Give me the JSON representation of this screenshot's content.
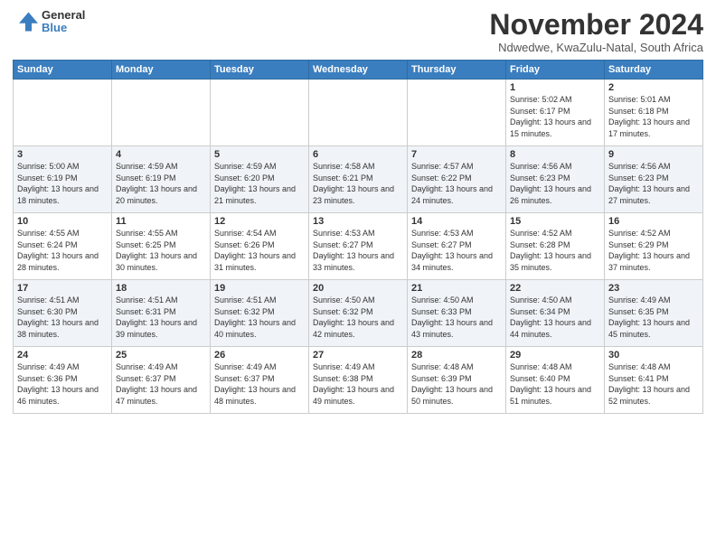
{
  "logo": {
    "general": "General",
    "blue": "Blue"
  },
  "title": "November 2024",
  "location": "Ndwedwe, KwaZulu-Natal, South Africa",
  "days_of_week": [
    "Sunday",
    "Monday",
    "Tuesday",
    "Wednesday",
    "Thursday",
    "Friday",
    "Saturday"
  ],
  "weeks": [
    [
      {
        "day": "",
        "info": ""
      },
      {
        "day": "",
        "info": ""
      },
      {
        "day": "",
        "info": ""
      },
      {
        "day": "",
        "info": ""
      },
      {
        "day": "",
        "info": ""
      },
      {
        "day": "1",
        "info": "Sunrise: 5:02 AM\nSunset: 6:17 PM\nDaylight: 13 hours\nand 15 minutes."
      },
      {
        "day": "2",
        "info": "Sunrise: 5:01 AM\nSunset: 6:18 PM\nDaylight: 13 hours\nand 17 minutes."
      }
    ],
    [
      {
        "day": "3",
        "info": "Sunrise: 5:00 AM\nSunset: 6:19 PM\nDaylight: 13 hours\nand 18 minutes."
      },
      {
        "day": "4",
        "info": "Sunrise: 4:59 AM\nSunset: 6:19 PM\nDaylight: 13 hours\nand 20 minutes."
      },
      {
        "day": "5",
        "info": "Sunrise: 4:59 AM\nSunset: 6:20 PM\nDaylight: 13 hours\nand 21 minutes."
      },
      {
        "day": "6",
        "info": "Sunrise: 4:58 AM\nSunset: 6:21 PM\nDaylight: 13 hours\nand 23 minutes."
      },
      {
        "day": "7",
        "info": "Sunrise: 4:57 AM\nSunset: 6:22 PM\nDaylight: 13 hours\nand 24 minutes."
      },
      {
        "day": "8",
        "info": "Sunrise: 4:56 AM\nSunset: 6:23 PM\nDaylight: 13 hours\nand 26 minutes."
      },
      {
        "day": "9",
        "info": "Sunrise: 4:56 AM\nSunset: 6:23 PM\nDaylight: 13 hours\nand 27 minutes."
      }
    ],
    [
      {
        "day": "10",
        "info": "Sunrise: 4:55 AM\nSunset: 6:24 PM\nDaylight: 13 hours\nand 28 minutes."
      },
      {
        "day": "11",
        "info": "Sunrise: 4:55 AM\nSunset: 6:25 PM\nDaylight: 13 hours\nand 30 minutes."
      },
      {
        "day": "12",
        "info": "Sunrise: 4:54 AM\nSunset: 6:26 PM\nDaylight: 13 hours\nand 31 minutes."
      },
      {
        "day": "13",
        "info": "Sunrise: 4:53 AM\nSunset: 6:27 PM\nDaylight: 13 hours\nand 33 minutes."
      },
      {
        "day": "14",
        "info": "Sunrise: 4:53 AM\nSunset: 6:27 PM\nDaylight: 13 hours\nand 34 minutes."
      },
      {
        "day": "15",
        "info": "Sunrise: 4:52 AM\nSunset: 6:28 PM\nDaylight: 13 hours\nand 35 minutes."
      },
      {
        "day": "16",
        "info": "Sunrise: 4:52 AM\nSunset: 6:29 PM\nDaylight: 13 hours\nand 37 minutes."
      }
    ],
    [
      {
        "day": "17",
        "info": "Sunrise: 4:51 AM\nSunset: 6:30 PM\nDaylight: 13 hours\nand 38 minutes."
      },
      {
        "day": "18",
        "info": "Sunrise: 4:51 AM\nSunset: 6:31 PM\nDaylight: 13 hours\nand 39 minutes."
      },
      {
        "day": "19",
        "info": "Sunrise: 4:51 AM\nSunset: 6:32 PM\nDaylight: 13 hours\nand 40 minutes."
      },
      {
        "day": "20",
        "info": "Sunrise: 4:50 AM\nSunset: 6:32 PM\nDaylight: 13 hours\nand 42 minutes."
      },
      {
        "day": "21",
        "info": "Sunrise: 4:50 AM\nSunset: 6:33 PM\nDaylight: 13 hours\nand 43 minutes."
      },
      {
        "day": "22",
        "info": "Sunrise: 4:50 AM\nSunset: 6:34 PM\nDaylight: 13 hours\nand 44 minutes."
      },
      {
        "day": "23",
        "info": "Sunrise: 4:49 AM\nSunset: 6:35 PM\nDaylight: 13 hours\nand 45 minutes."
      }
    ],
    [
      {
        "day": "24",
        "info": "Sunrise: 4:49 AM\nSunset: 6:36 PM\nDaylight: 13 hours\nand 46 minutes."
      },
      {
        "day": "25",
        "info": "Sunrise: 4:49 AM\nSunset: 6:37 PM\nDaylight: 13 hours\nand 47 minutes."
      },
      {
        "day": "26",
        "info": "Sunrise: 4:49 AM\nSunset: 6:37 PM\nDaylight: 13 hours\nand 48 minutes."
      },
      {
        "day": "27",
        "info": "Sunrise: 4:49 AM\nSunset: 6:38 PM\nDaylight: 13 hours\nand 49 minutes."
      },
      {
        "day": "28",
        "info": "Sunrise: 4:48 AM\nSunset: 6:39 PM\nDaylight: 13 hours\nand 50 minutes."
      },
      {
        "day": "29",
        "info": "Sunrise: 4:48 AM\nSunset: 6:40 PM\nDaylight: 13 hours\nand 51 minutes."
      },
      {
        "day": "30",
        "info": "Sunrise: 4:48 AM\nSunset: 6:41 PM\nDaylight: 13 hours\nand 52 minutes."
      }
    ]
  ]
}
